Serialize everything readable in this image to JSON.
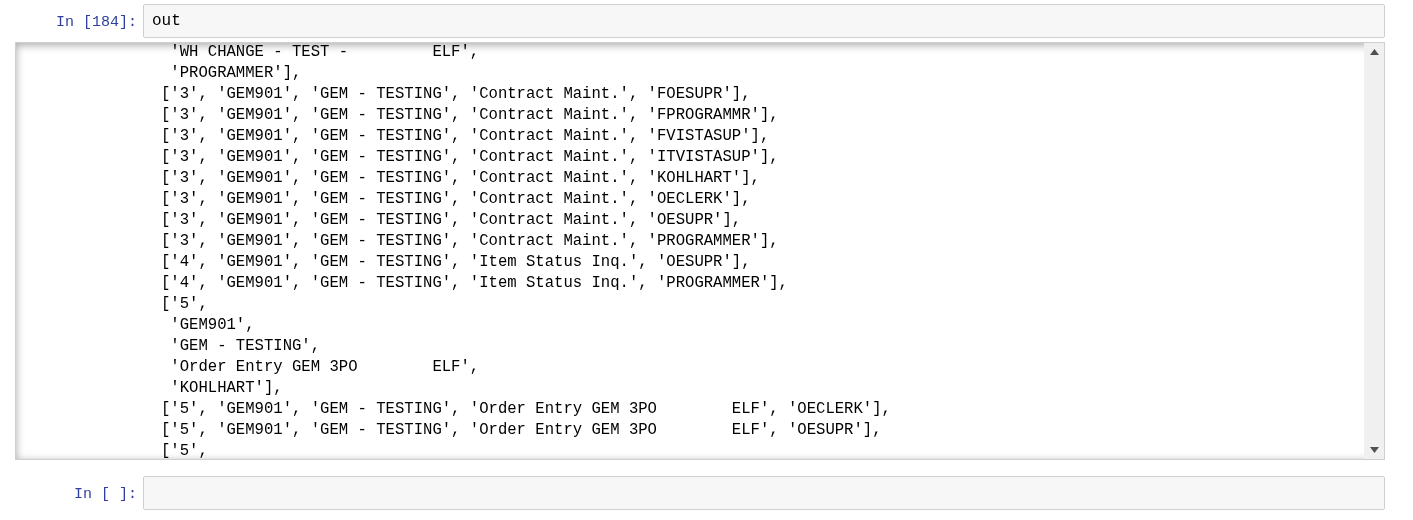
{
  "cells": [
    {
      "prompt": "In [184]:",
      "source": "out",
      "output": {
        "lines": [
          " 'WH CHANGE - TEST -         ELF',",
          " 'PROGRAMMER'],",
          "['3', 'GEM901', 'GEM - TESTING', 'Contract Maint.', 'FOESUPR'],",
          "['3', 'GEM901', 'GEM - TESTING', 'Contract Maint.', 'FPROGRAMMR'],",
          "['3', 'GEM901', 'GEM - TESTING', 'Contract Maint.', 'FVISTASUP'],",
          "['3', 'GEM901', 'GEM - TESTING', 'Contract Maint.', 'ITVISTASUP'],",
          "['3', 'GEM901', 'GEM - TESTING', 'Contract Maint.', 'KOHLHART'],",
          "['3', 'GEM901', 'GEM - TESTING', 'Contract Maint.', 'OECLERK'],",
          "['3', 'GEM901', 'GEM - TESTING', 'Contract Maint.', 'OESUPR'],",
          "['3', 'GEM901', 'GEM - TESTING', 'Contract Maint.', 'PROGRAMMER'],",
          "['4', 'GEM901', 'GEM - TESTING', 'Item Status Inq.', 'OESUPR'],",
          "['4', 'GEM901', 'GEM - TESTING', 'Item Status Inq.', 'PROGRAMMER'],",
          "['5',",
          " 'GEM901',",
          " 'GEM - TESTING',",
          " 'Order Entry GEM 3PO        ELF',",
          " 'KOHLHART'],",
          "['5', 'GEM901', 'GEM - TESTING', 'Order Entry GEM 3PO        ELF', 'OECLERK'],",
          "['5', 'GEM901', 'GEM - TESTING', 'Order Entry GEM 3PO        ELF', 'OESUPR'],",
          "['5',"
        ]
      }
    },
    {
      "prompt": "In [ ]:"
    }
  ]
}
